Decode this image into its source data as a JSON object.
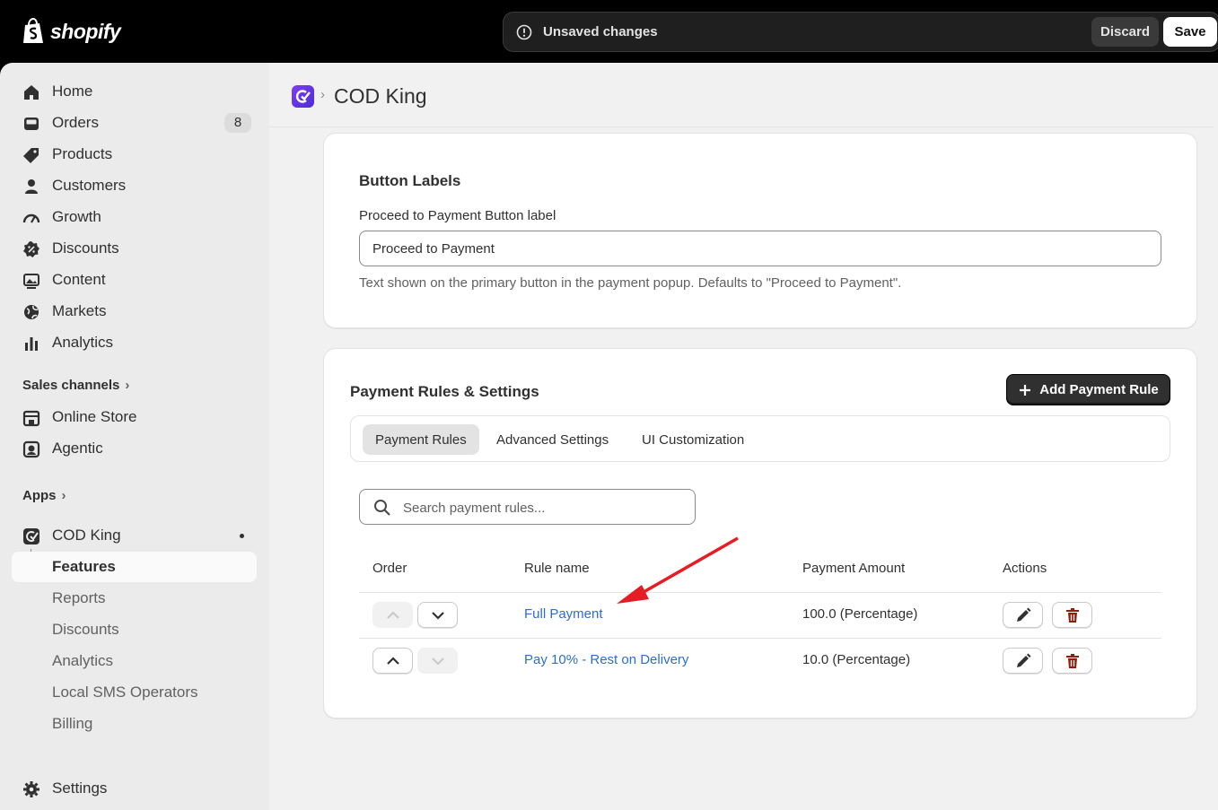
{
  "topbar": {
    "brand": "shopify",
    "unsaved_text": "Unsaved changes",
    "discard_label": "Discard",
    "save_label": "Save"
  },
  "sidebar": {
    "items": [
      {
        "label": "Home",
        "icon": "home-icon"
      },
      {
        "label": "Orders",
        "icon": "inbox-icon",
        "badge": "8"
      },
      {
        "label": "Products",
        "icon": "tag-icon"
      },
      {
        "label": "Customers",
        "icon": "person-icon"
      },
      {
        "label": "Growth",
        "icon": "gauge-icon"
      },
      {
        "label": "Discounts",
        "icon": "discount-icon"
      },
      {
        "label": "Content",
        "icon": "image-icon"
      },
      {
        "label": "Markets",
        "icon": "globe-icon"
      },
      {
        "label": "Analytics",
        "icon": "bar-chart-icon"
      }
    ],
    "sales_channels_label": "Sales channels",
    "channels": [
      {
        "label": "Online Store",
        "icon": "store-icon"
      },
      {
        "label": "Agentic",
        "icon": "agentic-icon"
      }
    ],
    "apps_label": "Apps",
    "app": {
      "label": "COD King",
      "icon": "cod-king-icon"
    },
    "app_sub_items": [
      "Features",
      "Reports",
      "Discounts",
      "Analytics",
      "Local SMS Operators",
      "Billing"
    ],
    "settings_label": "Settings"
  },
  "header": {
    "title": "COD King"
  },
  "button_labels_card": {
    "title": "Button Labels",
    "field_label": "Proceed to Payment Button label",
    "field_value": "Proceed to Payment",
    "help_text": "Text shown on the primary button in the payment popup. Defaults to \"Proceed to Payment\"."
  },
  "payment_card": {
    "title": "Payment Rules & Settings",
    "add_button": "Add Payment Rule",
    "tabs": [
      "Payment Rules",
      "Advanced Settings",
      "UI Customization"
    ],
    "active_tab": "Payment Rules",
    "search_placeholder": "Search payment rules...",
    "columns": [
      "Order",
      "Rule name",
      "Payment Amount",
      "Actions"
    ],
    "rows": [
      {
        "name": "Full Payment",
        "amount": "100.0 (Percentage)"
      },
      {
        "name": "Pay 10% - Rest on Delivery",
        "amount": "10.0 (Percentage)"
      }
    ]
  },
  "colors": {
    "accent": "#2c6ecb",
    "danger": "#8e1f0b",
    "annotation_arrow": "#e51c23"
  }
}
